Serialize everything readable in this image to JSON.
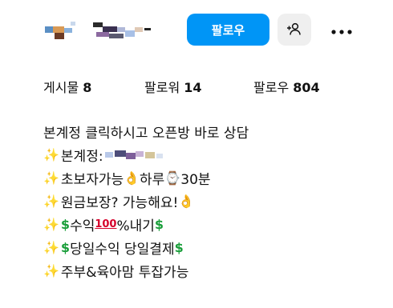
{
  "header": {
    "username_display": "",
    "follow_label": "팔로우",
    "suggest_icon": "add-person-icon",
    "more_icon": "more-dots-icon"
  },
  "stats": {
    "posts_label": "게시물",
    "posts_count": "8",
    "followers_label": "팔로워",
    "followers_count": "14",
    "following_label": "팔로우",
    "following_count": "804"
  },
  "bio": {
    "line1": "본계정 클릭하시고 오픈방 바로 상담",
    "line2_text": "본계정:",
    "line3_text_a": "초보자가능",
    "line3_text_b": "하루",
    "line3_text_c": "30분",
    "line4_text": "원금보장? 가능해요!",
    "line5_text_a": "수익",
    "line5_text_b": "%내기",
    "line6_text": "당일수익 당일결제",
    "line7_text": "주부&육아맘 투잡가능",
    "emoji_sparkles": "✨",
    "emoji_ok": "👌",
    "emoji_clock": "⌚",
    "emoji_dollar": "$",
    "emoji_hundred": "100"
  },
  "colors": {
    "accent": "#0095f6",
    "secondary_button": "#efefef",
    "text": "#111111"
  }
}
